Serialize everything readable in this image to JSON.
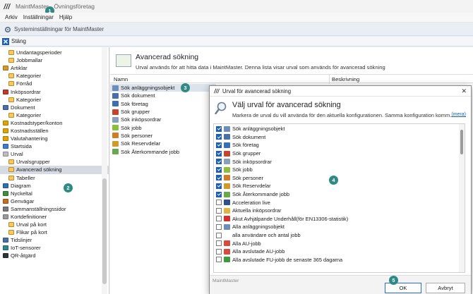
{
  "app": {
    "title": "MaintMaster - Övningsföretag"
  },
  "menu": [
    "Arkiv",
    "Inställningar",
    "Hjälp"
  ],
  "window": {
    "title": "Systeminställningar för MaintMaster"
  },
  "toolbar": {
    "close_label": "Stäng"
  },
  "badges": [
    "1",
    "2",
    "3",
    "4",
    "5"
  ],
  "sidebar": {
    "items": [
      {
        "label": "Undantagsperioder",
        "level": 1,
        "icon": "folder-icon",
        "color": "#f3c866"
      },
      {
        "label": "Jobbmallar",
        "level": 1,
        "icon": "folder-icon",
        "color": "#f3c866"
      },
      {
        "label": "Artiklar",
        "level": 0,
        "icon": "wrench-icon",
        "color": "#d29a2b"
      },
      {
        "label": "Kategorier",
        "level": 1,
        "icon": "folder-icon",
        "color": "#f3c866"
      },
      {
        "label": "Förråd",
        "level": 1,
        "icon": "folder-icon",
        "color": "#f3c866"
      },
      {
        "label": "Inköpsordrar",
        "level": 0,
        "icon": "cart-icon",
        "color": "#c0392b"
      },
      {
        "label": "Kategorier",
        "level": 1,
        "icon": "folder-icon",
        "color": "#f3c866"
      },
      {
        "label": "Dokument",
        "level": 0,
        "icon": "document-icon",
        "color": "#4a6fa5"
      },
      {
        "label": "Kategorier",
        "level": 1,
        "icon": "folder-icon",
        "color": "#f3c866"
      },
      {
        "label": "Kostnadstyper/konton",
        "level": 0,
        "icon": "coins-icon",
        "color": "#e0a400"
      },
      {
        "label": "Kostnadsställen",
        "level": 0,
        "icon": "coins-icon",
        "color": "#e0a400"
      },
      {
        "label": "Valutahantering",
        "level": 0,
        "icon": "coins-icon",
        "color": "#e0a400"
      },
      {
        "label": "Startsida",
        "level": 0,
        "icon": "home-icon",
        "color": "#3d7cc9"
      },
      {
        "label": "Urval",
        "level": 0,
        "icon": "filter-icon",
        "color": "#bdbdbd"
      },
      {
        "label": "Urvalsgrupper",
        "level": 1,
        "icon": "folder-icon",
        "color": "#f3c866"
      },
      {
        "label": "Avancerad sökning",
        "level": 1,
        "icon": "folder-icon",
        "color": "#f3c866",
        "selected": true
      },
      {
        "label": "Tabeller",
        "level": 1,
        "icon": "folder-icon",
        "color": "#f3c866"
      },
      {
        "label": "Diagram",
        "level": 0,
        "icon": "chart-icon",
        "color": "#2f6fb8"
      },
      {
        "label": "Nyckeltal",
        "level": 0,
        "icon": "gauge-icon",
        "color": "#3f8d3f"
      },
      {
        "label": "Genvägar",
        "level": 0,
        "icon": "shortcut-icon",
        "color": "#c07020"
      },
      {
        "label": "Sammanställningssidor",
        "level": 0,
        "icon": "pages-icon",
        "color": "#7a7a7a"
      },
      {
        "label": "Kortdefinitioner",
        "level": 0,
        "icon": "card-icon",
        "color": "#9b9b9b"
      },
      {
        "label": "Urval på kort",
        "level": 1,
        "icon": "folder-icon",
        "color": "#f3c866"
      },
      {
        "label": "Flikar på kort",
        "level": 1,
        "icon": "folder-icon",
        "color": "#f3c866"
      },
      {
        "label": "Tidslinjer",
        "level": 0,
        "icon": "timeline-icon",
        "color": "#4a6fa5"
      },
      {
        "label": "IoT-sensorer",
        "level": 0,
        "icon": "sensor-icon",
        "color": "#2f8a86"
      },
      {
        "label": "QR-åtgärd",
        "level": 0,
        "icon": "qr-icon",
        "color": "#333333"
      }
    ]
  },
  "main": {
    "title": "Avancerad sökning",
    "description": "Urval används för att hitta data i MaintMaster. Denna lista visar urval som används för avancerad sökning",
    "columns": [
      "Namn",
      "Beskrivning"
    ],
    "items": [
      {
        "label": "Sök anläggningsobjekt",
        "icon": "magnifier-icon",
        "color": "#6b8fb8",
        "selected": true
      },
      {
        "label": "Sök dokument",
        "icon": "document-icon",
        "color": "#4a6fa5"
      },
      {
        "label": "Sök företag",
        "icon": "building-icon",
        "color": "#3b6fb4"
      },
      {
        "label": "Sök grupper",
        "icon": "group-icon",
        "color": "#c4452b"
      },
      {
        "label": "Sök inköpsordrar",
        "icon": "cart-icon",
        "color": "#8aa0b8"
      },
      {
        "label": "Sök jobb",
        "icon": "job-icon",
        "color": "#8bbf3a"
      },
      {
        "label": "Sök personer",
        "icon": "person-icon",
        "color": "#d07d2a"
      },
      {
        "label": "Sök Reservdelar",
        "icon": "wrench-icon",
        "color": "#d29a2b"
      },
      {
        "label": "Sök Återkommande jobb",
        "icon": "recurring-icon",
        "color": "#6aa84f"
      }
    ]
  },
  "dialog": {
    "title": "Urval för avancerad sökning",
    "heading": "Välj urval för avancerad sökning",
    "description": "Markera de urval du vill använda för den aktuella konfigurationen. Samma konfiguration komm…",
    "more_link": "(mera)",
    "items": [
      {
        "label": "Sök anläggningsobjekt",
        "checked": true,
        "icon": "magnifier-icon",
        "color": "#6b8fb8"
      },
      {
        "label": "Sök dokument",
        "checked": true,
        "icon": "document-icon",
        "color": "#4a6fa5"
      },
      {
        "label": "Sök företag",
        "checked": true,
        "icon": "building-icon",
        "color": "#3b6fb4"
      },
      {
        "label": "Sök grupper",
        "checked": true,
        "icon": "group-icon",
        "color": "#c4452b"
      },
      {
        "label": "Sök inköpsordrar",
        "checked": true,
        "icon": "cart-icon",
        "color": "#8aa0b8"
      },
      {
        "label": "Sök jobb",
        "checked": true,
        "icon": "job-icon",
        "color": "#8bbf3a"
      },
      {
        "label": "Sök personer",
        "checked": true,
        "icon": "person-icon",
        "color": "#d07d2a"
      },
      {
        "label": "Sök Reservdelar",
        "checked": true,
        "icon": "wrench-icon",
        "color": "#d29a2b"
      },
      {
        "label": "Sök Återkommande jobb",
        "checked": true,
        "icon": "recurring-icon",
        "color": "#6aa84f"
      },
      {
        "label": "Acceleration live",
        "checked": false,
        "icon": "gauge-icon",
        "color": "#2f4f8f"
      },
      {
        "label": "Aktuella inköpsordrar",
        "checked": false,
        "icon": "cart-icon",
        "color": "#e3b341"
      },
      {
        "label": "Akut Avhjälpande Underhåll(för EN13306-statistik)",
        "checked": false,
        "icon": "pin-icon",
        "color": "#d03030"
      },
      {
        "label": "Alla anläggningsobjekt",
        "checked": false,
        "icon": "magnifier-icon",
        "color": "#6b8fb8"
      },
      {
        "label": "alla användare och antal jobb",
        "checked": false,
        "icon": "none",
        "color": "#ffffff"
      },
      {
        "label": "Alla AU-jobb",
        "checked": false,
        "icon": "play-icon",
        "color": "#d94a3a"
      },
      {
        "label": "Alla avslutade AU-jobb",
        "checked": false,
        "icon": "play-icon",
        "color": "#d94a3a"
      },
      {
        "label": "Alla avslutade FU-jobb de senaste 365 dagarna",
        "checked": false,
        "icon": "play-icon",
        "color": "#3f9a3f"
      }
    ],
    "footer_brand": "MaintMaster",
    "ok_label": "OK",
    "cancel_label": "Avbryt"
  }
}
